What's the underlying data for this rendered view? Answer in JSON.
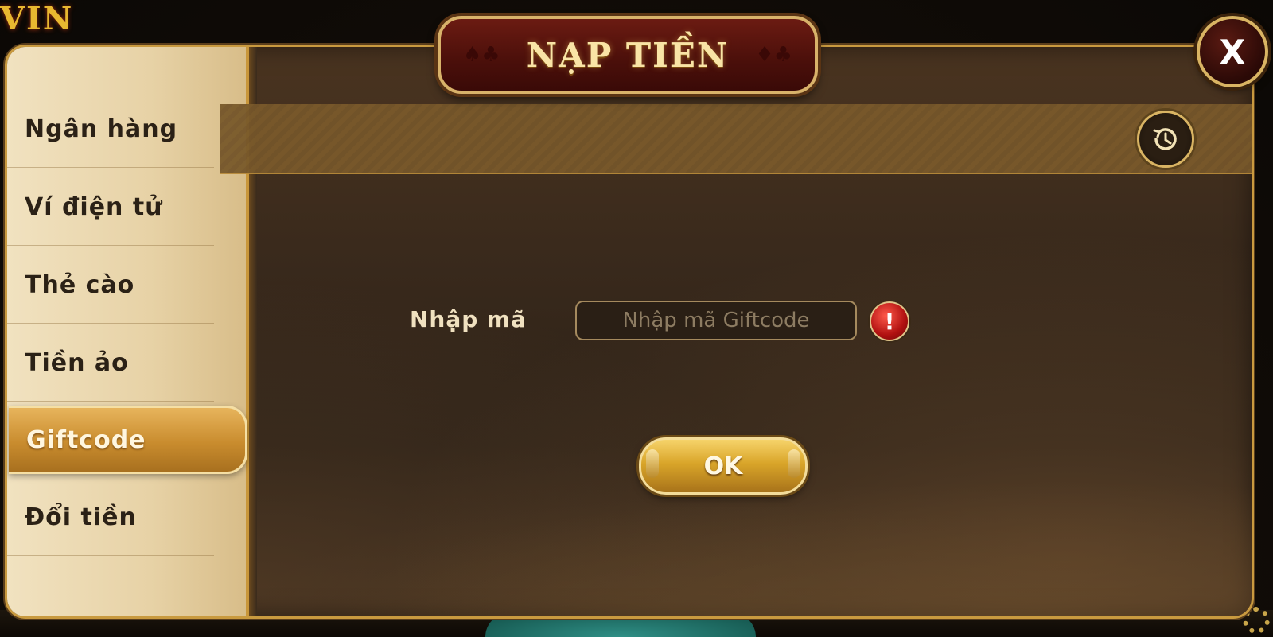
{
  "dialog": {
    "title": "NẠP TIỀN",
    "close_label": "X"
  },
  "sidebar": {
    "items": [
      {
        "label": "Ngân hàng"
      },
      {
        "label": "Ví điện tử"
      },
      {
        "label": "Thẻ cào"
      },
      {
        "label": "Tiền ảo"
      },
      {
        "label": "Giftcode",
        "active": true
      },
      {
        "label": "Đổi tiền"
      }
    ]
  },
  "form": {
    "label": "Nhập mã",
    "input_placeholder": "Nhập mã Giftcode",
    "input_value": "",
    "alert_symbol": "!",
    "submit_label": "OK"
  },
  "icons": {
    "history": "history-icon",
    "alert": "alert-icon",
    "close": "close-icon"
  },
  "colors": {
    "accent_gold": "#d9a529",
    "title_red": "#4a0f0a",
    "alert_red": "#b01010"
  }
}
